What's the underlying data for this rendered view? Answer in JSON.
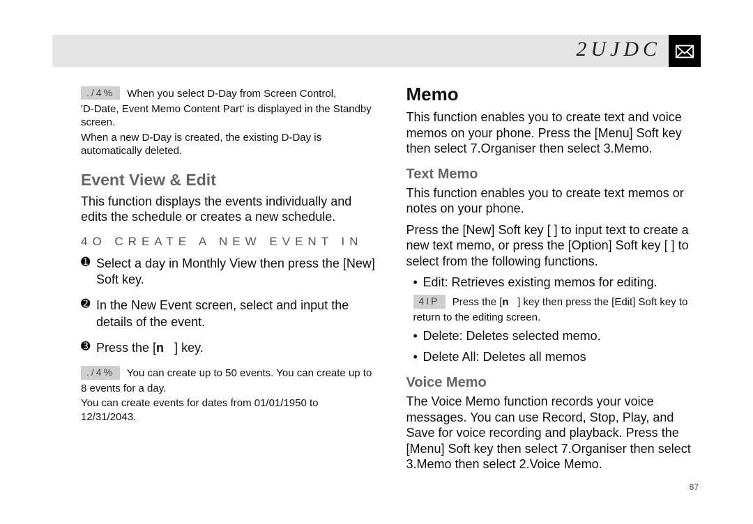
{
  "header": {
    "title": "2UJDC",
    "icon": "envelope-icon"
  },
  "page_number": "87",
  "left": {
    "note1": {
      "label": "./4%",
      "line1": "When you select D-Day from Screen Control,",
      "line2": "'D-Date, Event Memo Content Part' is displayed in the Standby screen.",
      "line3": "When a new D-Day is created, the existing D-Day is automatically deleted."
    },
    "event_view_edit": {
      "heading": "Event View & Edit",
      "intro": "This function displays the events individually and edits the schedule or creates a new schedule.",
      "proc_heading": "4O CREATE A NEW EVENT IN",
      "step1": "Select a day in Monthly View then press the [New] Soft key.",
      "step2": "In the New Event screen, select and input the details of the event.",
      "step3_a": "Press the [",
      "step3_key": "n",
      "step3_b": "] key."
    },
    "note2": {
      "label": "./4%",
      "line1": "You can create up to 50 events. You can create up to",
      "line2": "8 events for a day.",
      "line3": "You can create events for dates from 01/01/1950 to 12/31/2043."
    }
  },
  "right": {
    "memo": {
      "heading": "Memo",
      "intro": "This function enables you to create text and voice memos on your phone. Press the [Menu] Soft key then select 7.Organiser then select 3.Memo."
    },
    "text_memo": {
      "heading": "Text Memo",
      "intro": "This function enables you to create text memos or notes on your phone.",
      "press": "Press the [New] Soft key [      ] to input text to create a new text memo, or press the [Option] Soft key [      ] to select from the following functions.",
      "bullet_edit": "Edit: Retrieves existing memos for editing.",
      "tip": {
        "label": "4IP",
        "text_a": "Press the [",
        "key": "n",
        "text_b": "] key then press the [Edit] Soft key to",
        "text_c": "return to the editing screen."
      },
      "bullet_delete": "Delete: Deletes selected memo.",
      "bullet_delete_all": "Delete All: Deletes all memos"
    },
    "voice_memo": {
      "heading": "Voice Memo",
      "intro": "The Voice Memo function records your voice messages. You can use Record, Stop, Play, and Save for voice recording and playback. Press the [Menu] Soft key then select 7.Organiser then select 3.Memo then select 2.Voice Memo."
    }
  }
}
